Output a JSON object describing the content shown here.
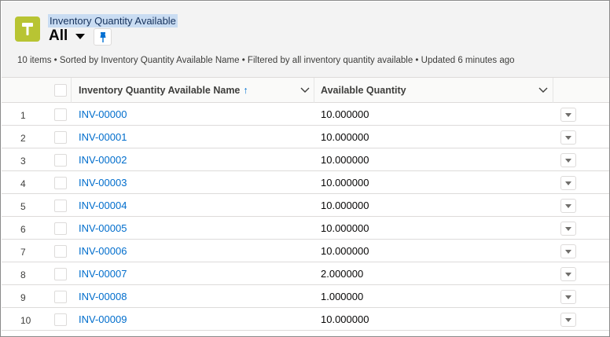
{
  "header": {
    "object_label": "Inventory Quantity Available",
    "list_view_name": "All",
    "summary": "10 items • Sorted by Inventory Quantity Available Name • Filtered by all inventory quantity available • Updated 6 minutes ago",
    "icon": "hammer-icon",
    "accent_color": "#b8c433"
  },
  "table": {
    "columns": [
      {
        "label": "Inventory Quantity Available Name",
        "sort_indicator": "↑"
      },
      {
        "label": "Available Quantity"
      }
    ],
    "rows": [
      {
        "num": "1",
        "name": "INV-00000",
        "qty": "10.000000"
      },
      {
        "num": "2",
        "name": "INV-00001",
        "qty": "10.000000"
      },
      {
        "num": "3",
        "name": "INV-00002",
        "qty": "10.000000"
      },
      {
        "num": "4",
        "name": "INV-00003",
        "qty": "10.000000"
      },
      {
        "num": "5",
        "name": "INV-00004",
        "qty": "10.000000"
      },
      {
        "num": "6",
        "name": "INV-00005",
        "qty": "10.000000"
      },
      {
        "num": "7",
        "name": "INV-00006",
        "qty": "10.000000"
      },
      {
        "num": "8",
        "name": "INV-00007",
        "qty": "2.000000"
      },
      {
        "num": "9",
        "name": "INV-00008",
        "qty": "1.000000"
      },
      {
        "num": "10",
        "name": "INV-00009",
        "qty": "10.000000"
      }
    ]
  }
}
